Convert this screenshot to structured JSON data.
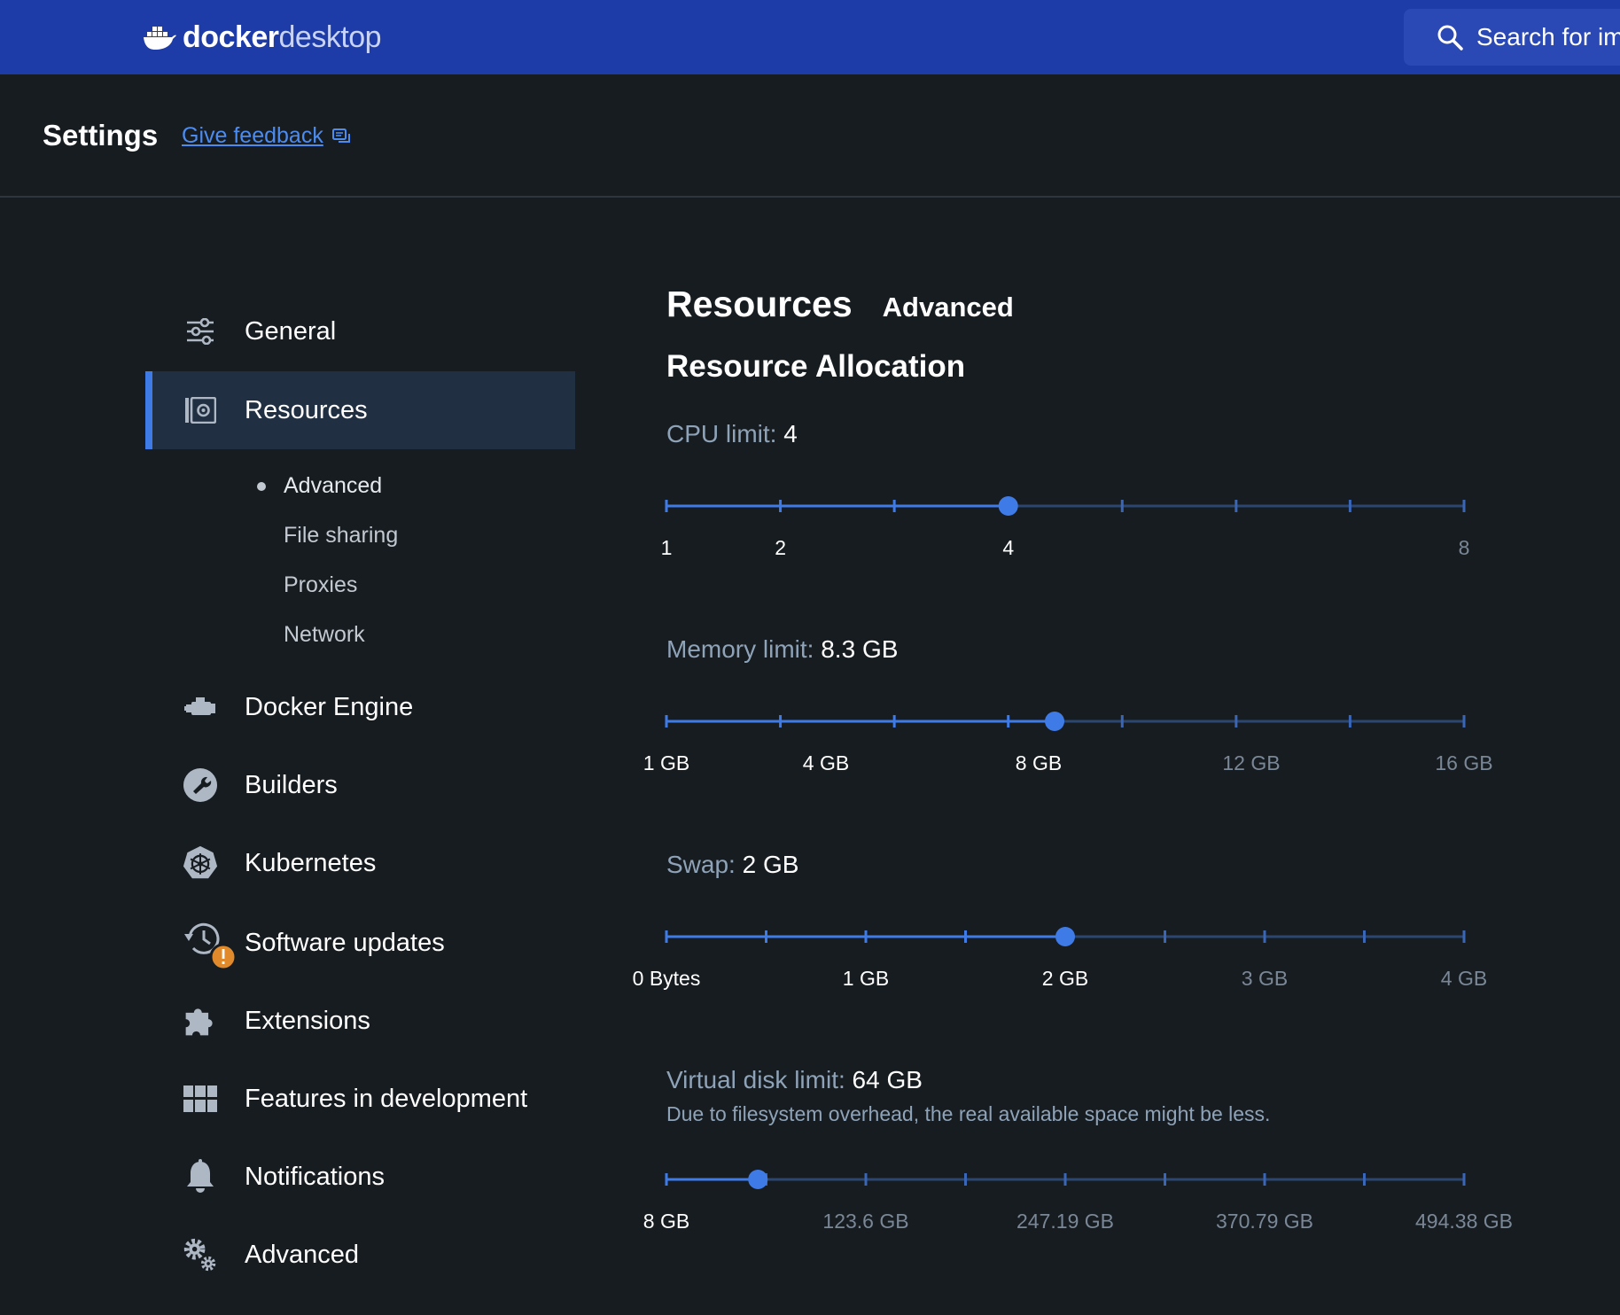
{
  "app": {
    "brand_bold": "docker",
    "brand_light": "desktop",
    "search_placeholder": "Search for im"
  },
  "header": {
    "title": "Settings",
    "feedback_label": "Give feedback"
  },
  "sidebar": {
    "items": [
      {
        "label": "General",
        "icon": "sliders-icon"
      },
      {
        "label": "Resources",
        "icon": "resources-icon",
        "active": true
      },
      {
        "label": "Docker Engine",
        "icon": "engine-icon"
      },
      {
        "label": "Builders",
        "icon": "wrench-icon"
      },
      {
        "label": "Kubernetes",
        "icon": "kubernetes-helm-icon"
      },
      {
        "label": "Software updates",
        "icon": "history-icon"
      },
      {
        "label": "Extensions",
        "icon": "puzzle-icon"
      },
      {
        "label": "Features in development",
        "icon": "grid-icon"
      },
      {
        "label": "Notifications",
        "icon": "bell-icon"
      },
      {
        "label": "Advanced",
        "icon": "gears-icon"
      }
    ],
    "sub_items": [
      {
        "label": "Advanced",
        "active": true
      },
      {
        "label": "File sharing"
      },
      {
        "label": "Proxies"
      },
      {
        "label": "Network"
      }
    ]
  },
  "main": {
    "tab_main": "Resources",
    "tab_sub": "Advanced",
    "section_title": "Resource Allocation",
    "sliders": [
      {
        "key": "CPU limit:",
        "value": "4",
        "fraction": 0.4286,
        "ticks": 8,
        "tick_labels": [
          {
            "text": "1",
            "pos": 0,
            "on": true
          },
          {
            "text": "2",
            "pos": 0.1429,
            "on": true
          },
          {
            "text": "4",
            "pos": 0.4286,
            "on": true
          },
          {
            "text": "8",
            "pos": 1,
            "on": false
          }
        ]
      },
      {
        "key": "Memory limit:",
        "value": "8.3 GB",
        "fraction": 0.4867,
        "ticks": 8,
        "tick_labels": [
          {
            "text": "1 GB",
            "pos": 0,
            "on": true
          },
          {
            "text": "4 GB",
            "pos": 0.2,
            "on": true
          },
          {
            "text": "8 GB",
            "pos": 0.4667,
            "on": true
          },
          {
            "text": "12 GB",
            "pos": 0.7333,
            "on": false
          },
          {
            "text": "16 GB",
            "pos": 1,
            "on": false
          }
        ]
      },
      {
        "key": "Swap:",
        "value": "2 GB",
        "fraction": 0.5,
        "ticks": 9,
        "tick_labels": [
          {
            "text": "0 Bytes",
            "pos": 0,
            "on": true
          },
          {
            "text": "1 GB",
            "pos": 0.25,
            "on": true
          },
          {
            "text": "2 GB",
            "pos": 0.5,
            "on": true
          },
          {
            "text": "3 GB",
            "pos": 0.75,
            "on": false
          },
          {
            "text": "4 GB",
            "pos": 1,
            "on": false
          }
        ]
      },
      {
        "key": "Virtual disk limit:",
        "value": "64 GB",
        "note": "Due to filesystem overhead, the real available space might be less.",
        "fraction": 0.1147,
        "ticks": 9,
        "tick_labels": [
          {
            "text": "8 GB",
            "pos": 0,
            "on": true
          },
          {
            "text": "123.6 GB",
            "pos": 0.25,
            "on": false
          },
          {
            "text": "247.19 GB",
            "pos": 0.5,
            "on": false
          },
          {
            "text": "370.79 GB",
            "pos": 0.75,
            "on": false
          },
          {
            "text": "494.38 GB",
            "pos": 1,
            "on": false
          }
        ]
      }
    ]
  },
  "colors": {
    "topbar": "#1d3ca8",
    "background": "#171c21",
    "accent": "#3f7be6",
    "track_off": "#2b4670",
    "warning_badge": "#e08a2c"
  }
}
